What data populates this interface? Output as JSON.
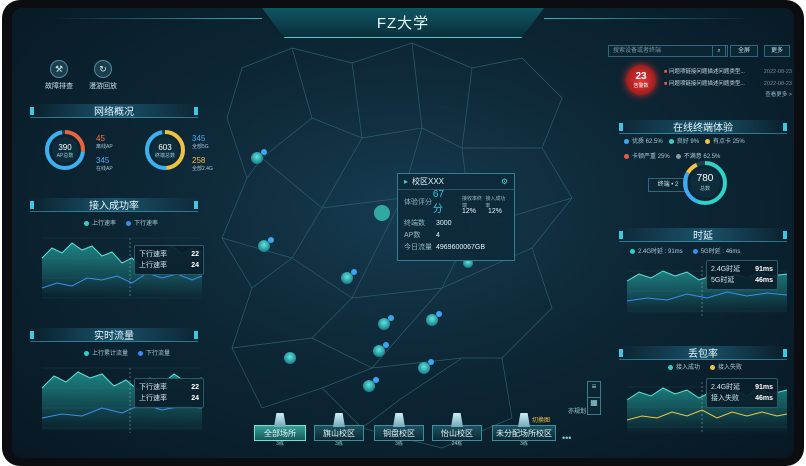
{
  "header": {
    "title": "FZ大学"
  },
  "top_left_buttons": [
    {
      "label": "故障排查",
      "icon": "wrench-icon"
    },
    {
      "label": "漫游回放",
      "icon": "replay-icon"
    }
  ],
  "network_overview": {
    "title": "网络概况",
    "ap": {
      "value": "390",
      "label": "AP总数",
      "online_num": "45",
      "online_label": "离线AP",
      "offline_num": "345",
      "offline_label": "在线AP"
    },
    "terminal": {
      "value": "603",
      "label": "终端总数",
      "n1": "345",
      "n1_label": "全部5G",
      "n2": "258",
      "n2_label": "全部2.4G"
    }
  },
  "access_success": {
    "title": "接入成功率",
    "legend": [
      "上行速率",
      "下行速率"
    ],
    "tooltip": [
      {
        "label": "下行速率",
        "value": "22"
      },
      {
        "label": "上行速率",
        "value": "24"
      }
    ]
  },
  "realtime_traffic": {
    "title": "实时流量",
    "legend": [
      "上行累计流量",
      "下行流量"
    ],
    "tooltip": [
      {
        "label": "下行速率",
        "value": "22"
      },
      {
        "label": "上行速率",
        "value": "24"
      }
    ]
  },
  "popup": {
    "title": "校区XXX",
    "score_label": "体验评分",
    "score_value": "67分",
    "stat_labels": [
      "接收率终端",
      "接入成功率"
    ],
    "stat_values": [
      "12%",
      "12%"
    ],
    "rows": [
      {
        "k": "终端数",
        "v": "3000"
      },
      {
        "k": "AP数",
        "v": "4"
      },
      {
        "k": "今日流量",
        "v": "4969600067GB"
      }
    ]
  },
  "search": {
    "placeholder": "搜索设备或者终端",
    "btn1": "全屏",
    "btn2": "更多"
  },
  "alarm": {
    "count": "23",
    "label": "告警数"
  },
  "alerts": {
    "items": [
      {
        "text": "问题项链接问题描述问题类型...",
        "date": "2022-08-23"
      },
      {
        "text": "问题项链接问题描述问题类型...",
        "date": "2022-08-23"
      }
    ],
    "more": "查看更多 >"
  },
  "online_experience": {
    "title": "在线终端体验",
    "legend": [
      "优质 62.5%",
      "良好 9%",
      "有点卡 25%",
      "卡顿严重 25%",
      "不满意 62.5%"
    ],
    "legend_colors": [
      "#3fa9f5",
      "#2ed3c8",
      "#f5c542",
      "#e85c4a",
      "#8a9aa5"
    ],
    "center_value": "780",
    "center_label": "总数",
    "side_label": "终端 • 2"
  },
  "latency": {
    "title": "时延",
    "legend": [
      "2.4G时延 : 91ms",
      "5G时延 : 46ms"
    ],
    "tooltip": [
      {
        "label": "2.4G时延",
        "value": "91ms"
      },
      {
        "label": "5G时延",
        "value": "46ms"
      }
    ]
  },
  "packet_loss": {
    "title": "丢包率",
    "legend": [
      "接入成功",
      "接入失败"
    ],
    "tooltip": [
      {
        "label": "2.4G时延",
        "value": "91ms"
      },
      {
        "label": "接入失败",
        "value": "46ms"
      }
    ]
  },
  "campus_tabs": [
    {
      "name": "全部场所",
      "count": "3栋",
      "active": true
    },
    {
      "name": "旗山校区",
      "count": "3栋",
      "active": false
    },
    {
      "name": "铜盘校区",
      "count": "3栋",
      "active": false
    },
    {
      "name": "怡山校区",
      "count": "24栋",
      "active": false
    },
    {
      "name": "未分配场所校区",
      "count": "3栋",
      "active": false
    }
  ],
  "more_dots": "•••",
  "map_controls": {
    "label": "切换图",
    "sub": "亦规划"
  }
}
